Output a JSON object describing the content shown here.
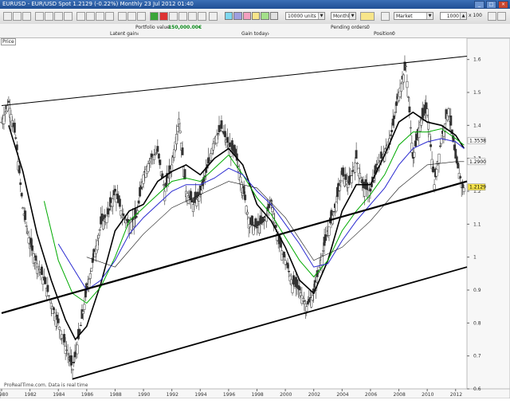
{
  "window": {
    "title": "EURUSD - EUR/USD Spot   1.2129 (-0.22%)   Monthly  23 Jul 2012 01:40"
  },
  "toolbar": {
    "units_value": "10000 units",
    "timeframe_value": "Monthly",
    "order_type_value": "Market",
    "quantity_value": "1000",
    "multiplier_value": "x 100",
    "colors": [
      "#7fd8f0",
      "#9f9fe0",
      "#f3a0c0",
      "#f7e58a",
      "#a4e08a",
      "#e0e0e0"
    ]
  },
  "info": {
    "portfolio_label": "Portfolio value:",
    "portfolio_value": "150,000.00€",
    "pending_label": "Pending orders:",
    "pending_value": "0",
    "latent_label": "Latent gain:",
    "latent_value": "-",
    "gain_today_label": "Gain today:",
    "gain_today_value": "-",
    "position_label": "Position:",
    "position_value": "0"
  },
  "chart": {
    "price_label": "Price",
    "watermark": "ProRealTime.com. Data is real time",
    "current_price": "1.2129",
    "series_tags": [
      "1.3538",
      "1.2900",
      "1.2129"
    ],
    "x_ticks": [
      "1980",
      "1982",
      "1984",
      "1986",
      "1988",
      "1990",
      "1992",
      "1994",
      "1996",
      "1998",
      "2000",
      "2002",
      "2004",
      "2006",
      "2008",
      "2010",
      "2012"
    ],
    "y_ticks": [
      "1.6",
      "1.5",
      "1.4",
      "1.3",
      "1.2",
      "1.1",
      "1",
      "0.9",
      "0.8",
      "0.7",
      "0.6"
    ]
  },
  "chart_data": {
    "type": "line",
    "title": "EURUSD - EUR/USD Spot Monthly",
    "xlabel": "",
    "ylabel": "",
    "xlim": [
      1980,
      2012.8
    ],
    "ylim": [
      0.6,
      1.65
    ],
    "grid": false,
    "series": [
      {
        "values": [
          [
            1980,
            1.41
          ],
          [
            1980.5,
            1.47
          ],
          [
            1981,
            1.36
          ],
          [
            1981.5,
            1.15
          ],
          [
            1982,
            1.04
          ],
          [
            1982.5,
            0.98
          ],
          [
            1983,
            0.93
          ],
          [
            1983.5,
            0.86
          ],
          [
            1984,
            0.8
          ],
          [
            1984.5,
            0.73
          ],
          [
            1985,
            0.66
          ],
          [
            1985.5,
            0.77
          ],
          [
            1986,
            0.9
          ],
          [
            1986.5,
            1.0
          ],
          [
            1987,
            1.1
          ],
          [
            1987.5,
            1.13
          ],
          [
            1988,
            1.2
          ],
          [
            1988.5,
            1.13
          ],
          [
            1989,
            1.1
          ],
          [
            1989.5,
            1.12
          ],
          [
            1990,
            1.25
          ],
          [
            1990.5,
            1.3
          ],
          [
            1991,
            1.32
          ],
          [
            1991.5,
            1.2
          ],
          [
            1992,
            1.28
          ],
          [
            1992.5,
            1.42
          ],
          [
            1993,
            1.2
          ],
          [
            1993.5,
            1.16
          ],
          [
            1994,
            1.19
          ],
          [
            1994.5,
            1.27
          ],
          [
            1995,
            1.36
          ],
          [
            1995.5,
            1.39
          ],
          [
            1996,
            1.34
          ],
          [
            1996.5,
            1.31
          ],
          [
            1997,
            1.21
          ],
          [
            1997.5,
            1.1
          ],
          [
            1998,
            1.09
          ],
          [
            1998.5,
            1.11
          ],
          [
            1999,
            1.17
          ],
          [
            1999.5,
            1.05
          ],
          [
            2000,
            0.99
          ],
          [
            2000.5,
            0.92
          ],
          [
            2001,
            0.9
          ],
          [
            2001.5,
            0.85
          ],
          [
            2002,
            0.89
          ],
          [
            2002.5,
            0.99
          ],
          [
            2003,
            1.08
          ],
          [
            2003.5,
            1.15
          ],
          [
            2004,
            1.25
          ],
          [
            2004.5,
            1.22
          ],
          [
            2005,
            1.3
          ],
          [
            2005.5,
            1.21
          ],
          [
            2006,
            1.2
          ],
          [
            2006.5,
            1.28
          ],
          [
            2007,
            1.32
          ],
          [
            2007.5,
            1.38
          ],
          [
            2008,
            1.5
          ],
          [
            2008.5,
            1.58
          ],
          [
            2009,
            1.3
          ],
          [
            2009.5,
            1.41
          ],
          [
            2010,
            1.45
          ],
          [
            2010.5,
            1.22
          ],
          [
            2011,
            1.36
          ],
          [
            2011.5,
            1.45
          ],
          [
            2012,
            1.3
          ],
          [
            2012.5,
            1.21
          ]
        ]
      },
      {
        "values": [
          [
            1980.5,
            1.4
          ],
          [
            1981.5,
            1.26
          ],
          [
            1982.5,
            1.07
          ],
          [
            1983.5,
            0.93
          ],
          [
            1984.5,
            0.81
          ],
          [
            1985.2,
            0.75
          ],
          [
            1986,
            0.79
          ],
          [
            1987,
            0.92
          ],
          [
            1988,
            1.08
          ],
          [
            1989,
            1.14
          ],
          [
            1990,
            1.16
          ],
          [
            1991,
            1.23
          ],
          [
            1992,
            1.26
          ],
          [
            1993,
            1.28
          ],
          [
            1994,
            1.25
          ],
          [
            1995,
            1.3
          ],
          [
            1996,
            1.33
          ],
          [
            1997,
            1.28
          ],
          [
            1998,
            1.16
          ],
          [
            1999,
            1.11
          ],
          [
            2000,
            1.03
          ],
          [
            2001,
            0.93
          ],
          [
            2002,
            0.89
          ],
          [
            2003,
            0.99
          ],
          [
            2004,
            1.14
          ],
          [
            2005,
            1.22
          ],
          [
            2006,
            1.22
          ],
          [
            2007,
            1.31
          ],
          [
            2008,
            1.41
          ],
          [
            2009,
            1.44
          ],
          [
            2010,
            1.41
          ],
          [
            2011,
            1.4
          ],
          [
            2012,
            1.37
          ],
          [
            2012.6,
            1.33
          ]
        ]
      },
      {
        "values": [
          [
            1983,
            1.17
          ],
          [
            1984,
            0.99
          ],
          [
            1985,
            0.89
          ],
          [
            1986,
            0.86
          ],
          [
            1987,
            0.91
          ],
          [
            1988,
            1.0
          ],
          [
            1989,
            1.11
          ],
          [
            1990,
            1.15
          ],
          [
            1991,
            1.19
          ],
          [
            1992,
            1.23
          ],
          [
            1993,
            1.24
          ],
          [
            1994,
            1.23
          ],
          [
            1995,
            1.27
          ],
          [
            1996,
            1.31
          ],
          [
            1997,
            1.25
          ],
          [
            1998,
            1.18
          ],
          [
            1999,
            1.13
          ],
          [
            2000,
            1.06
          ],
          [
            2001,
            0.99
          ],
          [
            2002,
            0.94
          ],
          [
            2003,
            0.99
          ],
          [
            2004,
            1.08
          ],
          [
            2005,
            1.14
          ],
          [
            2006,
            1.19
          ],
          [
            2007,
            1.25
          ],
          [
            2008,
            1.34
          ],
          [
            2009,
            1.38
          ],
          [
            2010,
            1.38
          ],
          [
            2011,
            1.39
          ],
          [
            2012,
            1.36
          ],
          [
            2012.6,
            1.34
          ]
        ]
      },
      {
        "values": [
          [
            1984,
            1.04
          ],
          [
            1985,
            0.97
          ],
          [
            1986,
            0.9
          ],
          [
            1987,
            0.93
          ],
          [
            1988,
            0.99
          ],
          [
            1989,
            1.07
          ],
          [
            1990,
            1.12
          ],
          [
            1991,
            1.16
          ],
          [
            1992,
            1.2
          ],
          [
            1993,
            1.22
          ],
          [
            1994,
            1.22
          ],
          [
            1995,
            1.24
          ],
          [
            1996,
            1.27
          ],
          [
            1997,
            1.25
          ],
          [
            1998,
            1.2
          ],
          [
            1999,
            1.16
          ],
          [
            2000,
            1.1
          ],
          [
            2001,
            1.04
          ],
          [
            2002,
            0.97
          ],
          [
            2003,
            0.98
          ],
          [
            2004,
            1.05
          ],
          [
            2005,
            1.11
          ],
          [
            2006,
            1.16
          ],
          [
            2007,
            1.21
          ],
          [
            2008,
            1.28
          ],
          [
            2009,
            1.33
          ],
          [
            2010,
            1.35
          ],
          [
            2011,
            1.36
          ],
          [
            2012,
            1.35
          ],
          [
            2012.6,
            1.33
          ]
        ]
      },
      {
        "values": [
          [
            1986,
            1.0
          ],
          [
            1988,
            0.97
          ],
          [
            1990,
            1.07
          ],
          [
            1992,
            1.15
          ],
          [
            1994,
            1.19
          ],
          [
            1996,
            1.23
          ],
          [
            1998,
            1.21
          ],
          [
            2000,
            1.12
          ],
          [
            2002,
            0.99
          ],
          [
            2004,
            1.03
          ],
          [
            2006,
            1.11
          ],
          [
            2008,
            1.21
          ],
          [
            2010,
            1.28
          ],
          [
            2012,
            1.29
          ],
          [
            2012.6,
            1.29
          ]
        ]
      }
    ],
    "trendlines": [
      [
        [
          1980,
          1.46
        ],
        [
          2012.8,
          1.61
        ]
      ],
      [
        [
          1980,
          0.83
        ],
        [
          2012.8,
          1.23
        ]
      ],
      [
        [
          1985,
          0.63
        ],
        [
          2012.8,
          0.97
        ]
      ]
    ]
  }
}
